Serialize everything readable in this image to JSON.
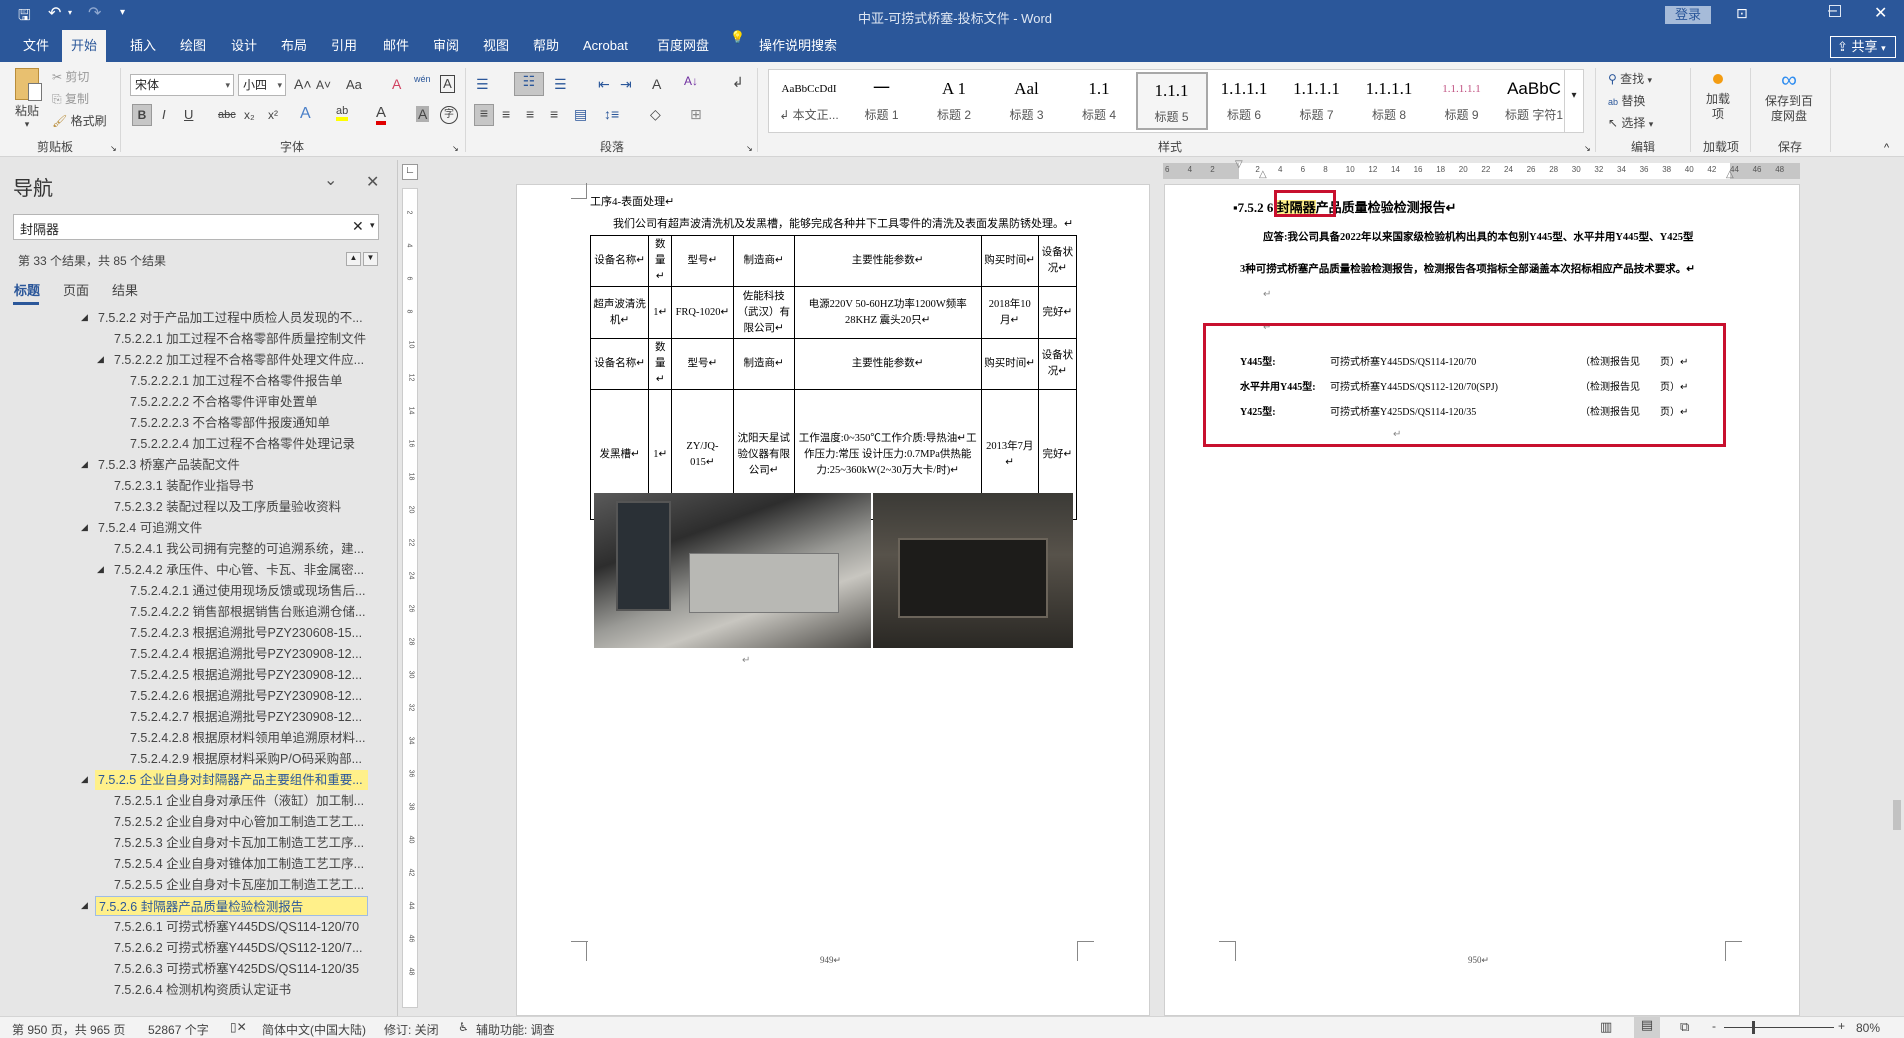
{
  "window": {
    "title": "中亚-可捞式桥塞-投标文件 - Word",
    "login": "登录",
    "share": "共享"
  },
  "quick_access": {
    "save": "save-icon",
    "undo": "undo-icon",
    "redo": "redo-icon",
    "customize": "▾"
  },
  "tabs": [
    {
      "label": "文件"
    },
    {
      "label": "开始",
      "active": true
    },
    {
      "label": "插入"
    },
    {
      "label": "绘图"
    },
    {
      "label": "设计"
    },
    {
      "label": "布局"
    },
    {
      "label": "引用"
    },
    {
      "label": "邮件"
    },
    {
      "label": "审阅"
    },
    {
      "label": "视图"
    },
    {
      "label": "帮助"
    },
    {
      "label": "Acrobat"
    },
    {
      "label": "百度网盘"
    },
    {
      "label": "操作说明搜索"
    }
  ],
  "ribbon": {
    "clipboard": {
      "label": "剪贴板",
      "paste": "粘贴",
      "cut": "剪切",
      "copy": "复制",
      "format_painter": "格式刷"
    },
    "font": {
      "label": "字体",
      "font_name": "宋体",
      "font_size": "小四",
      "bold": "B",
      "italic": "I",
      "underline": "U",
      "strike": "abc",
      "sub": "x₂",
      "sup": "x²",
      "grow": "A˄",
      "shrink": "A˅",
      "case": "Aa",
      "phonetic": "wén",
      "charborder": "A",
      "effects": "A",
      "highlight": "ab",
      "color": "A",
      "shade": "A",
      "enclose": "字",
      "highlight_color": "#ffff00",
      "font_color": "#e00000"
    },
    "paragraph": {
      "label": "段落"
    },
    "styles": {
      "label": "样式",
      "items": [
        {
          "preview": "AaBbCcDdI",
          "label": "↲ 本文正..."
        },
        {
          "preview": "一",
          "label": "标题 1"
        },
        {
          "preview": "A 1",
          "label": "标题 2"
        },
        {
          "preview": "Aal",
          "label": "标题 3"
        },
        {
          "preview": "1.1",
          "label": "标题 4"
        },
        {
          "preview": "1.1.1",
          "label": "标题 5",
          "selected": true
        },
        {
          "preview": "1.1.1.1",
          "label": "标题 6"
        },
        {
          "preview": "1.1.1.1",
          "label": "标题 7"
        },
        {
          "preview": "1.1.1.1",
          "label": "标题 8"
        },
        {
          "preview": "1.1.1.1.1",
          "label": "标题 9"
        },
        {
          "preview": "AaBbC",
          "label": "标题 字符1"
        }
      ]
    },
    "editing": {
      "label": "编辑",
      "find": "查找",
      "replace": "替换",
      "select": "选择"
    },
    "addins": {
      "label": "加载项",
      "button": "加载项"
    },
    "save": {
      "label": "保存",
      "button": "保存到百度网盘"
    }
  },
  "ruler": {
    "ticks": [
      "6",
      "4",
      "2",
      "",
      "2",
      "4",
      "6",
      "8",
      "10",
      "12",
      "14",
      "16",
      "18",
      "20",
      "22",
      "24",
      "26",
      "28",
      "30",
      "32",
      "34",
      "36",
      "38",
      "40",
      "42",
      "44",
      "46",
      "48"
    ]
  },
  "vruler": {
    "ticks": [
      "2",
      "4",
      "6",
      "8",
      "10",
      "12",
      "14",
      "16",
      "18",
      "20",
      "22",
      "24",
      "26",
      "28",
      "30",
      "32",
      "34",
      "36",
      "38",
      "40",
      "42",
      "44",
      "46",
      "48"
    ]
  },
  "nav": {
    "title": "导航",
    "search_value": "封隔器",
    "result_info": "第 33 个结果，共 85 个结果",
    "tabs": [
      "标题",
      "页面",
      "结果"
    ],
    "items": [
      {
        "t": "7.5.2.2 对于产品加工过程中质检人员发现的不...",
        "lv": 0,
        "arrow": true
      },
      {
        "t": "7.5.2.2.1 加工过程不合格零部件质量控制文件",
        "lv": 1
      },
      {
        "t": "7.5.2.2.2 加工过程不合格零部件处理文件应...",
        "lv": 1,
        "arrow": true
      },
      {
        "t": "7.5.2.2.2.1 加工过程不合格零件报告单",
        "lv": 2
      },
      {
        "t": "7.5.2.2.2.2 不合格零件评审处置单",
        "lv": 2
      },
      {
        "t": "7.5.2.2.2.3 不合格零部件报废通知单",
        "lv": 2
      },
      {
        "t": "7.5.2.2.2.4 加工过程不合格零件处理记录",
        "lv": 2
      },
      {
        "t": "7.5.2.3 桥塞产品装配文件",
        "lv": 0,
        "arrow": true
      },
      {
        "t": "7.5.2.3.1 装配作业指导书",
        "lv": 1
      },
      {
        "t": "7.5.2.3.2 装配过程以及工序质量验收资料",
        "lv": 1
      },
      {
        "t": "7.5.2.4 可追溯文件",
        "lv": 0,
        "arrow": true
      },
      {
        "t": "7.5.2.4.1 我公司拥有完整的可追溯系统，建...",
        "lv": 1
      },
      {
        "t": "7.5.2.4.2 承压件、中心管、卡瓦、非金属密...",
        "lv": 1,
        "arrow": true
      },
      {
        "t": "7.5.2.4.2.1 通过使用现场反馈或现场售后...",
        "lv": 2
      },
      {
        "t": "7.5.2.4.2.2 销售部根据销售台账追溯仓储...",
        "lv": 2
      },
      {
        "t": "7.5.2.4.2.3 根据追溯批号PZY230608-15...",
        "lv": 2
      },
      {
        "t": "7.5.2.4.2.4 根据追溯批号PZY230908-12...",
        "lv": 2
      },
      {
        "t": "7.5.2.4.2.5 根据追溯批号PZY230908-12...",
        "lv": 2
      },
      {
        "t": "7.5.2.4.2.6 根据追溯批号PZY230908-12...",
        "lv": 2
      },
      {
        "t": "7.5.2.4.2.7 根据追溯批号PZY230908-12...",
        "lv": 2
      },
      {
        "t": "7.5.2.4.2.8 根据原材料领用单追溯原材料...",
        "lv": 2
      },
      {
        "t": "7.5.2.4.2.9 根据原材料采购P/O码采购部...",
        "lv": 2
      },
      {
        "t": "7.5.2.5 企业自身对封隔器产品主要组件和重要...",
        "lv": 0,
        "arrow": true,
        "hl": true
      },
      {
        "t": "7.5.2.5.1 企业自身对承压件（液缸）加工制...",
        "lv": 1
      },
      {
        "t": "7.5.2.5.2 企业自身对中心管加工制造工艺工...",
        "lv": 1
      },
      {
        "t": "7.5.2.5.3 企业自身对卡瓦加工制造工艺工序...",
        "lv": 1
      },
      {
        "t": "7.5.2.5.4 企业自身对锥体加工制造工艺工序...",
        "lv": 1
      },
      {
        "t": "7.5.2.5.5 企业自身对卡瓦座加工制造工艺工...",
        "lv": 1
      },
      {
        "t": "7.5.2.6 封隔器产品质量检验检测报告",
        "lv": 0,
        "arrow": true,
        "hl": true,
        "cur": true
      },
      {
        "t": "7.5.2.6.1 可捞式桥塞Y445DS/QS114-120/70",
        "lv": 1
      },
      {
        "t": "7.5.2.6.2 可捞式桥塞Y445DS/QS112-120/7...",
        "lv": 1
      },
      {
        "t": "7.5.2.6.3 可捞式桥塞Y425DS/QS114-120/35",
        "lv": 1
      },
      {
        "t": "7.5.2.6.4 检测机构资质认定证书",
        "lv": 1
      }
    ]
  },
  "page1": {
    "heading": "工序4-表面处理↵",
    "intro": "我们公司有超声波清洗机及发黑槽，能够完成各种井下工具零件的清洗及表面发黑防锈处理。↵",
    "table": {
      "header": [
        "设备名称↵",
        "数量↵",
        "型号↵",
        "制造商↵",
        "主要性能参数↵",
        "购买时间↵",
        "设备状况↵"
      ],
      "rows": [
        [
          "超声波清洗机↵",
          "1↵",
          "FRQ-1020↵",
          "佐能科技（武汉）有限公司↵",
          "电源220V 50-60HZ功率1200W频率28KHZ 震头20只↵",
          "2018年10月↵",
          "完好↵"
        ],
        [
          "发黑槽↵",
          "1↵",
          "ZY/JQ-015↵",
          "沈阳天星试验仪器有限公司↵",
          "工作温度:0~350℃工作介质:导热油↵工作压力:常压 设计压力:0.7MPa供热能力:25~360kW(2~30万大卡/时)↵",
          "2013年7月↵",
          "完好↵"
        ]
      ]
    },
    "after_photo": "↵",
    "page_number": "949↵"
  },
  "page2": {
    "heading_prefix": "7.5.2 ",
    "heading_match_pre": "6 ",
    "heading_match": "封隔器",
    "heading_rest": "产品质量检验检测报告↵",
    "para1": "应答:我公司具备2022年以来国家级检验机构出具的本包别Y445型、水平井用Y445型、Y425型",
    "para2": "3种可捞式桥塞产品质量检验检测报告，检测报告各项指标全部涵盖本次招标相应产品技术要求。↵",
    "blank": "↵",
    "reports": [
      {
        "type": "Y445型:",
        "model": "可捞式桥塞Y445DS/QS114-120/70",
        "ref": "（检测报告见　　页）↵"
      },
      {
        "type": "水平井用Y445型:",
        "model": "可捞式桥塞Y445DS/QS112-120/70(SPJ)",
        "ref": "（检测报告见　　页）↵"
      },
      {
        "type": "Y425型:",
        "model": "可捞式桥塞Y425DS/QS114-120/35",
        "ref": "（检测报告见　　页）↵"
      }
    ],
    "page_number": "950↵",
    "annotation_color": "#c8102e"
  },
  "status": {
    "page": "第 950 页，共 965 页",
    "words": "52867 个字",
    "language": "简体中文(中国大陆)",
    "track": "修订: 关闭",
    "accessibility": "辅助功能: 调查",
    "zoom": "80%",
    "zoom_value": 80
  }
}
